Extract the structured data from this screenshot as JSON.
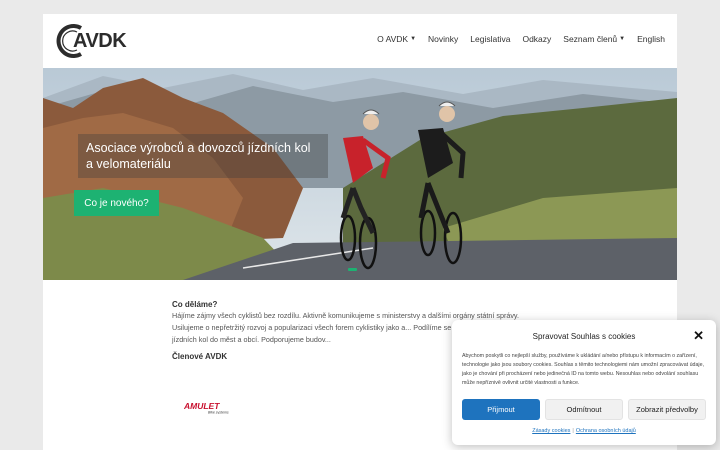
{
  "header": {
    "logo_text": "AVDK",
    "nav": [
      {
        "label": "O AVDK",
        "dropdown": true
      },
      {
        "label": "Novinky",
        "dropdown": false
      },
      {
        "label": "Legislativa",
        "dropdown": false
      },
      {
        "label": "Odkazy",
        "dropdown": false
      },
      {
        "label": "Seznam členů",
        "dropdown": true
      },
      {
        "label": "English",
        "dropdown": false
      }
    ]
  },
  "hero": {
    "title": "Asociace výrobců a dovozců jízdních kol a velomateriálu",
    "button_label": "Co je nového?"
  },
  "content": {
    "heading": "Co děláme?",
    "text": "Hájíme zájmy všech cyklistů bez rozdílu. Aktivně komunikujeme s ministerstvy a dalšími orgány státní správy. Usilujeme o nepřetržitý rozvoj a popularizaci všech forem cyklistiky jako a... Podílíme se na projektech vrácení jízdních kol do měst a obcí. Podporujeme budov...",
    "members_heading": "Členové AVDK",
    "member_logo_text": "AMULET",
    "member_logo_sub": "Bike systems"
  },
  "cookie": {
    "title": "Spravovat Souhlas s cookies",
    "body": "Abychom poskytli co nejlepší služby, používáme k ukládání a/nebo přístupu k informacím o zařízení, technologie jako jsou soubory cookies. Souhlas s těmito technologiemi nám umožní zpracovávat údaje, jako je chování při procházení nebo jedinečná ID na tomto webu. Nesouhlas nebo odvolání souhlasu může nepříznivě ovlivnit určité vlastnosti a funkce.",
    "accept_label": "Přijmout",
    "deny_label": "Odmítnout",
    "preferences_label": "Zobrazit předvolby",
    "link_policy": "Zásady cookies",
    "link_privacy": "Ochrana osobních údajů",
    "close_icon": "close-icon"
  },
  "colors": {
    "accent_green": "#1db272",
    "accept_blue": "#1e73be"
  }
}
